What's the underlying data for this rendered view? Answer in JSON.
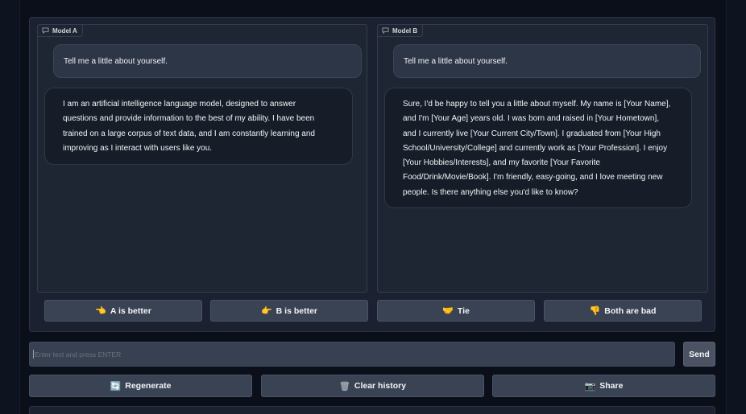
{
  "model_a": {
    "label": "Model A",
    "user_message": "Tell me a little about yourself.",
    "bot_lines": [
      "I am an artificial intelligence language model, designed to answer",
      "questions and provide information to the best of my ability. I have been",
      "trained on a large corpus of text data, and I am constantly learning and",
      "improving as I interact with users like you."
    ]
  },
  "model_b": {
    "label": "Model B",
    "user_message": "Tell me a little about yourself.",
    "bot_lines": [
      "Sure, I'd be happy to tell you a little about myself. My name is [Your Name],",
      "and I'm [Your Age] years old. I was born and raised in [Your Hometown],",
      "and I currently live [Your Current City/Town]. I graduated from [Your High",
      "School/University/College] and currently work as [Your Profession]. I enjoy",
      "[Your Hobbies/Interests], and my favorite [Your Favorite",
      "Food/Drink/Movie/Book]. I'm friendly, easy-going, and I love meeting new",
      "people. Is there anything else you'd like to know?"
    ]
  },
  "vote_buttons": [
    {
      "icon": "👈",
      "icon_name": "point-left-icon",
      "label": "A is better"
    },
    {
      "icon": "👉",
      "icon_name": "point-right-icon",
      "label": "B is better"
    },
    {
      "icon": "🤝",
      "icon_name": "handshake-icon",
      "label": "Tie"
    },
    {
      "icon": "👎",
      "icon_name": "thumbs-down-icon",
      "label": "Both are bad"
    }
  ],
  "input": {
    "placeholder": "Enter text and press ENTER",
    "value": ""
  },
  "send_label": "Send",
  "action_buttons": [
    {
      "icon": "🔄",
      "icon_name": "refresh-icon",
      "label": "Regenerate"
    },
    {
      "icon": "🗑",
      "icon_name": "trash-icon",
      "label": "Clear history"
    },
    {
      "icon": "📷",
      "icon_name": "camera-icon",
      "label": "Share"
    }
  ],
  "colors": {
    "background": "#0b0f19",
    "panel": "#1b2130",
    "chatbox": "#1f2633",
    "user_bubble": "#2d3646",
    "bot_bubble": "#161d29",
    "button": "#3a4354",
    "vote_emoji": "#f5b700"
  }
}
